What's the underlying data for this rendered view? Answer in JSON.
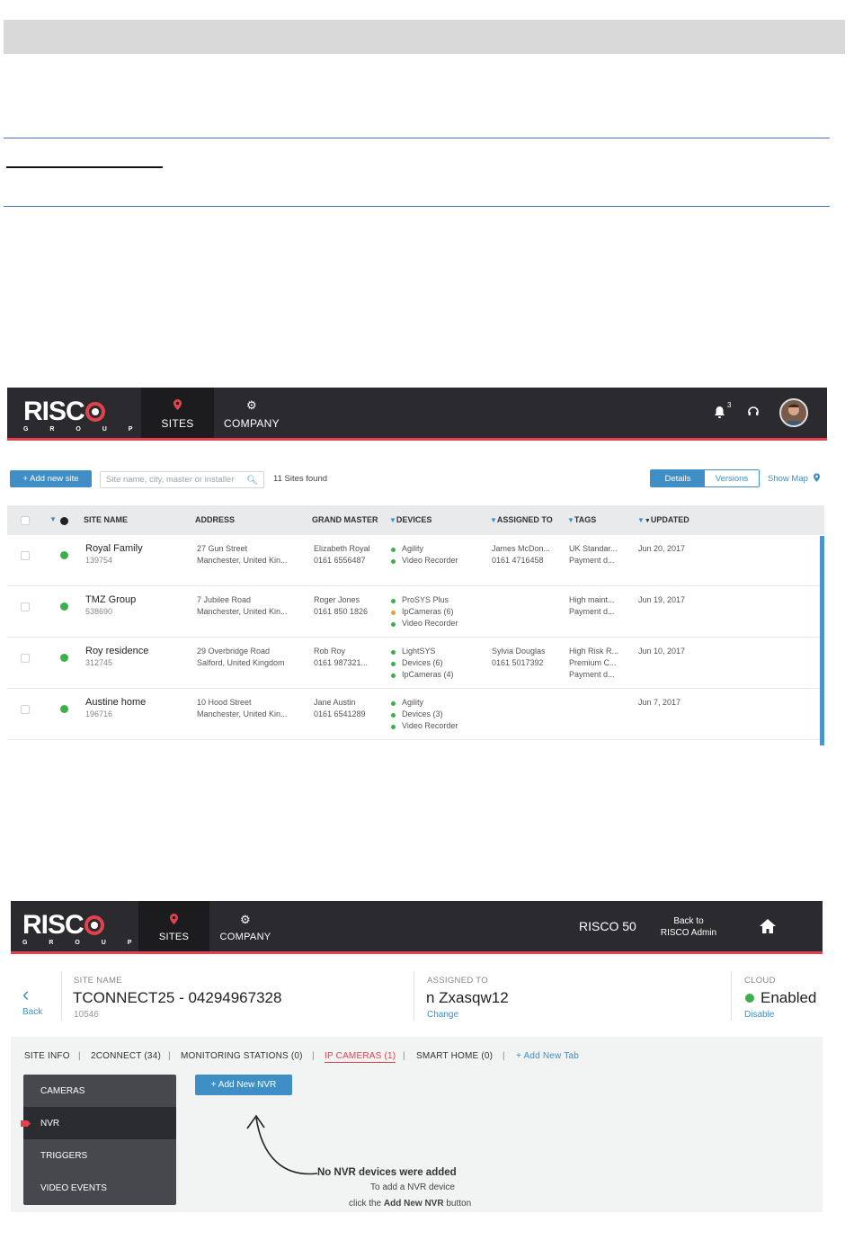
{
  "screen1": {
    "brand": {
      "word": "RISC",
      "group": "G R O U P"
    },
    "nav": {
      "sites": "SITES",
      "company": "COMPANY"
    },
    "notifications_count": "3",
    "toolbar": {
      "add_site": "+  Add new site",
      "search_placeholder": "Site name, city, master or installer",
      "sites_found": "11 Sites found",
      "details": "Details",
      "versions": "Versions",
      "show_map": "Show Map"
    },
    "columns": {
      "site_name": "SITE NAME",
      "address": "ADDRESS",
      "grand_master": "GRAND MASTER",
      "devices": "DEVICES",
      "assigned_to": "ASSIGNED TO",
      "tags": "TAGS",
      "updated": "UPDATED"
    },
    "rows": [
      {
        "name": "Royal Family",
        "id": "139754",
        "address": [
          "27 Gun Street",
          "Manchester, United Kin..."
        ],
        "master": [
          "Elizabeth Royal",
          "0161 6556487"
        ],
        "devices": [
          "Agility",
          "Video Recorder"
        ],
        "assigned": [
          "James McDon...",
          "0161 4716458"
        ],
        "tags": [
          "UK Standar...",
          "Payment d..."
        ],
        "updated": "Jun 20, 2017"
      },
      {
        "name": "TMZ Group",
        "id": "538690",
        "address": [
          "7 Jubilee Road",
          "Manchester, United Kin..."
        ],
        "master": [
          "Roger Jones",
          "0161 850 1826"
        ],
        "devices": [
          "ProSYS Plus",
          "IpCameras (6)",
          "Video Recorder"
        ],
        "assigned": [],
        "tags": [
          "High maint...",
          "Payment d..."
        ],
        "updated": "Jun 19, 2017"
      },
      {
        "name": "Roy residence",
        "id": "312745",
        "address": [
          "29 Overbridge Road",
          "Salford, United Kingdom"
        ],
        "master": [
          "Rob Roy",
          "0161 987321..."
        ],
        "devices": [
          "LightSYS",
          "Devices (6)",
          "IpCameras (4)"
        ],
        "assigned": [
          "Sylvia Douglas",
          "0161 5017392"
        ],
        "tags": [
          "High Risk R...",
          "Premium C...",
          "Payment d..."
        ],
        "updated": "Jun 10, 2017"
      },
      {
        "name": "Austine home",
        "id": "196716",
        "address": [
          "10 Hood Street",
          "Manchester, United Kin..."
        ],
        "master": [
          "Jane Austin",
          "0161 6541289"
        ],
        "devices": [
          "Agility",
          "Devices (3)",
          "Video Recorder"
        ],
        "assigned": [],
        "tags": [],
        "updated": "Jun 7, 2017"
      }
    ]
  },
  "screen2": {
    "brand": {
      "word": "RISC",
      "group": "G R O U P"
    },
    "nav": {
      "sites": "SITES",
      "company": "COMPANY",
      "product": "RISCO 50",
      "back_line1": "Back to",
      "back_line2": "RISCO Admin"
    },
    "header": {
      "back": "Back",
      "site_name_label": "SITE NAME",
      "site_name": "TCONNECT25 - 04294967328",
      "site_id": "10546",
      "assigned_label": "ASSIGNED TO",
      "assigned": "n Zxasqw12",
      "change": "Change",
      "cloud_label": "CLOUD",
      "cloud_status": "Enabled",
      "disable": "Disable"
    },
    "tabs": [
      "SITE INFO",
      "2CONNECT (34)",
      "MONITORING STATIONS (0)",
      "IP CAMERAS (1)",
      "SMART HOME (0)",
      "+ Add New Tab"
    ],
    "menu": [
      "CAMERAS",
      "NVR",
      "TRIGGERS",
      "VIDEO EVENTS"
    ],
    "add_nvr": "+  Add New NVR",
    "empty": {
      "title": "No NVR devices were added",
      "line1": "To add a NVR device",
      "line2_pre": "click the ",
      "line2_bold": "Add New NVR",
      "line2_post": " button"
    }
  },
  "colors": {
    "accent": "#3f8fc6",
    "brand_red": "#e2424c",
    "nav_bg": "#2b2a2e",
    "status_ok": "#3bb04a",
    "status_warn": "#f0a030"
  }
}
